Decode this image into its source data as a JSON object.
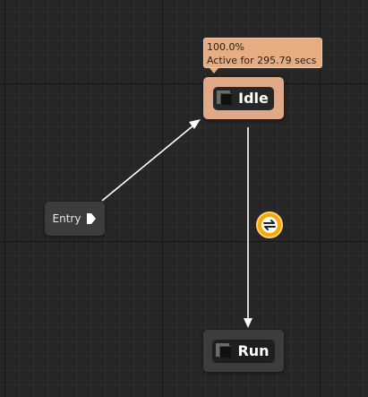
{
  "entry": {
    "label": "Entry"
  },
  "states": [
    {
      "label": "Idle",
      "active": true
    },
    {
      "label": "Run",
      "active": false
    }
  ],
  "tooltip": {
    "percent": "100.0%",
    "active_text": "Active for 295.79 secs"
  },
  "colors": {
    "canvas": "#262626",
    "active_state": "#dfa886",
    "tooltip_bg": "#e6ad82",
    "inactive_state": "#3c3c3c",
    "transition_icon": "#f6a800",
    "wire": "#ffffff"
  },
  "icons": {
    "entry_pin": "play-pin-icon",
    "state": "state-node-icon",
    "transition": "transition-rule-icon"
  }
}
